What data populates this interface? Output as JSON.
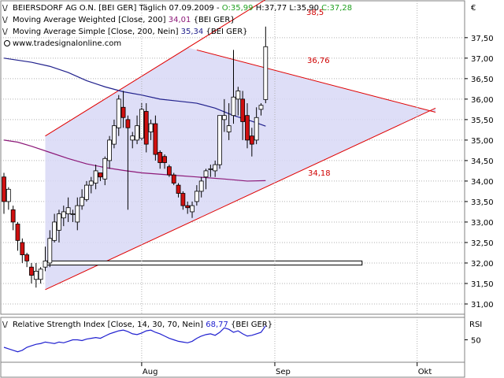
{
  "currency_symbol": "€",
  "colors": {
    "up": "#ffffff",
    "down": "#d01010",
    "channel_fill": "#d8d8f6",
    "channel_line": "#e00000",
    "ma_simple": "#20208c",
    "ma_weighted": "#8c1878",
    "rsi": "#2020d0",
    "grid": "#b0b0b0",
    "value_label": "#d00000"
  },
  "legend": {
    "price": {
      "name": "BEIERSDORF AG O.N. [BEI GER]  Täglich 07.09.2009 -",
      "o_label": "O:35,99",
      "h_label": "H:37,77",
      "l_label": "L:35,90",
      "c_label": "C:37,28"
    },
    "wma": {
      "name": "Moving Average Weighted [Close, 200]",
      "value": "34,01",
      "symbol": "{BEI GER}"
    },
    "sma": {
      "name": "Moving Average Simple [Close, 200, Nein]",
      "value": "35,34",
      "symbol": "{BEI GER}"
    },
    "source": "www.tradesignalonline.com"
  },
  "rsi_legend": {
    "name": "Relative Strength Index [Close, 14, 30, 70, Nein]",
    "value": "68,77",
    "symbol": "{BEI GER}",
    "axis_title": "RSI"
  },
  "annotations": {
    "upper_channel": "38,5",
    "mid_line": "36,76",
    "lower_channel": "34,18"
  },
  "chart_data": [
    {
      "type": "candlestick",
      "title": "BEIERSDORF AG O.N. [BEI GER] Täglich",
      "ylim": [
        30.75,
        38.4
      ],
      "y_ticks": [
        "31,00",
        "31,50",
        "32,00",
        "32,50",
        "33,00",
        "33,50",
        "34,00",
        "34,50",
        "35,00",
        "35,50",
        "36,00",
        "36,50",
        "37,00",
        "37,50"
      ],
      "y_tick_values": [
        31.0,
        31.5,
        32.0,
        32.5,
        33.0,
        33.5,
        34.0,
        34.5,
        35.0,
        35.5,
        36.0,
        36.5,
        37.0,
        37.5
      ],
      "x_ticks": [
        "Aug",
        "Sep",
        "Okt"
      ],
      "x_tick_index": [
        30,
        59,
        90
      ],
      "grid": true,
      "candles": [
        {
          "o": 34.1,
          "h": 34.2,
          "l": 33.2,
          "c": 33.5
        },
        {
          "o": 33.5,
          "h": 33.85,
          "l": 33.3,
          "c": 33.8
        },
        {
          "o": 33.3,
          "h": 33.4,
          "l": 32.8,
          "c": 33.0
        },
        {
          "o": 32.95,
          "h": 33.0,
          "l": 32.3,
          "c": 32.55
        },
        {
          "o": 32.5,
          "h": 32.6,
          "l": 32.0,
          "c": 32.2
        },
        {
          "o": 32.2,
          "h": 32.25,
          "l": 31.9,
          "c": 32.05
        },
        {
          "o": 31.9,
          "h": 32.0,
          "l": 31.5,
          "c": 31.7
        },
        {
          "o": 31.6,
          "h": 32.0,
          "l": 31.4,
          "c": 31.8
        },
        {
          "o": 31.6,
          "h": 31.9,
          "l": 31.5,
          "c": 31.85
        },
        {
          "o": 31.9,
          "h": 32.4,
          "l": 31.8,
          "c": 32.05
        },
        {
          "o": 32.0,
          "h": 32.8,
          "l": 31.9,
          "c": 32.6
        },
        {
          "o": 32.55,
          "h": 33.2,
          "l": 32.5,
          "c": 33.0
        },
        {
          "o": 32.8,
          "h": 33.3,
          "l": 32.5,
          "c": 33.2
        },
        {
          "o": 33.1,
          "h": 33.4,
          "l": 32.9,
          "c": 33.25
        },
        {
          "o": 33.2,
          "h": 33.6,
          "l": 33.0,
          "c": 33.35
        },
        {
          "o": 33.2,
          "h": 33.3,
          "l": 33.0,
          "c": 33.2
        },
        {
          "o": 33.0,
          "h": 33.6,
          "l": 32.8,
          "c": 33.4
        },
        {
          "o": 33.4,
          "h": 33.8,
          "l": 33.3,
          "c": 33.6
        },
        {
          "o": 33.55,
          "h": 34.0,
          "l": 33.5,
          "c": 33.9
        },
        {
          "o": 33.9,
          "h": 34.1,
          "l": 33.7,
          "c": 34.0
        },
        {
          "o": 33.95,
          "h": 34.4,
          "l": 33.8,
          "c": 34.25
        },
        {
          "o": 34.2,
          "h": 34.2,
          "l": 34.0,
          "c": 34.1
        },
        {
          "o": 34.05,
          "h": 34.6,
          "l": 33.9,
          "c": 34.55
        },
        {
          "o": 34.5,
          "h": 35.1,
          "l": 34.3,
          "c": 35.0
        },
        {
          "o": 34.9,
          "h": 35.5,
          "l": 34.8,
          "c": 35.35
        },
        {
          "o": 35.3,
          "h": 36.1,
          "l": 35.1,
          "c": 36.0
        },
        {
          "o": 35.8,
          "h": 36.2,
          "l": 35.3,
          "c": 35.55
        },
        {
          "o": 35.5,
          "h": 35.6,
          "l": 33.3,
          "c": 35.3
        },
        {
          "o": 35.0,
          "h": 35.2,
          "l": 34.8,
          "c": 35.1
        },
        {
          "o": 35.0,
          "h": 35.6,
          "l": 34.9,
          "c": 35.35
        },
        {
          "o": 35.05,
          "h": 35.9,
          "l": 35.0,
          "c": 35.75
        },
        {
          "o": 35.7,
          "h": 35.9,
          "l": 34.7,
          "c": 34.9
        },
        {
          "o": 35.2,
          "h": 35.5,
          "l": 35.0,
          "c": 35.4
        },
        {
          "o": 35.4,
          "h": 35.6,
          "l": 34.5,
          "c": 34.65
        },
        {
          "o": 34.7,
          "h": 34.75,
          "l": 34.3,
          "c": 34.45
        },
        {
          "o": 34.6,
          "h": 34.65,
          "l": 34.3,
          "c": 34.45
        },
        {
          "o": 34.35,
          "h": 34.4,
          "l": 34.1,
          "c": 34.15
        },
        {
          "o": 34.15,
          "h": 34.2,
          "l": 33.9,
          "c": 33.95
        },
        {
          "o": 33.9,
          "h": 33.95,
          "l": 33.6,
          "c": 33.7
        },
        {
          "o": 33.7,
          "h": 33.75,
          "l": 33.3,
          "c": 33.4
        },
        {
          "o": 33.4,
          "h": 33.5,
          "l": 33.2,
          "c": 33.35
        },
        {
          "o": 33.25,
          "h": 33.5,
          "l": 33.1,
          "c": 33.4
        },
        {
          "o": 33.5,
          "h": 33.9,
          "l": 33.4,
          "c": 33.75
        },
        {
          "o": 33.75,
          "h": 34.1,
          "l": 33.6,
          "c": 34.0
        },
        {
          "o": 34.1,
          "h": 34.3,
          "l": 33.8,
          "c": 34.25
        },
        {
          "o": 34.3,
          "h": 34.4,
          "l": 34.1,
          "c": 34.3
        },
        {
          "o": 34.25,
          "h": 34.5,
          "l": 34.1,
          "c": 34.4
        },
        {
          "o": 34.4,
          "h": 35.6,
          "l": 34.3,
          "c": 35.6
        },
        {
          "o": 35.5,
          "h": 36.0,
          "l": 35.2,
          "c": 35.6
        },
        {
          "o": 35.2,
          "h": 35.9,
          "l": 35.0,
          "c": 35.35
        },
        {
          "o": 35.6,
          "h": 37.2,
          "l": 35.4,
          "c": 36.05
        },
        {
          "o": 36.0,
          "h": 36.3,
          "l": 35.6,
          "c": 36.2
        },
        {
          "o": 36.0,
          "h": 36.2,
          "l": 35.0,
          "c": 35.45
        },
        {
          "o": 35.6,
          "h": 35.9,
          "l": 34.8,
          "c": 35.0
        },
        {
          "o": 35.1,
          "h": 35.3,
          "l": 34.6,
          "c": 34.9
        },
        {
          "o": 35.0,
          "h": 35.8,
          "l": 34.9,
          "c": 35.55
        },
        {
          "o": 35.75,
          "h": 35.9,
          "l": 35.6,
          "c": 35.85
        },
        {
          "o": 35.99,
          "h": 37.77,
          "l": 35.9,
          "c": 37.28
        }
      ],
      "sma_200": [
        {
          "i": 0,
          "v": 37.0
        },
        {
          "i": 3,
          "v": 36.95
        },
        {
          "i": 6,
          "v": 36.9
        },
        {
          "i": 10,
          "v": 36.8
        },
        {
          "i": 14,
          "v": 36.65
        },
        {
          "i": 18,
          "v": 36.45
        },
        {
          "i": 22,
          "v": 36.3
        },
        {
          "i": 26,
          "v": 36.18
        },
        {
          "i": 30,
          "v": 36.1
        },
        {
          "i": 34,
          "v": 36.0
        },
        {
          "i": 38,
          "v": 35.95
        },
        {
          "i": 42,
          "v": 35.9
        },
        {
          "i": 46,
          "v": 35.78
        },
        {
          "i": 50,
          "v": 35.6
        },
        {
          "i": 54,
          "v": 35.46
        },
        {
          "i": 57,
          "v": 35.34
        }
      ],
      "wma_200": [
        {
          "i": 0,
          "v": 35.0
        },
        {
          "i": 3,
          "v": 34.95
        },
        {
          "i": 6,
          "v": 34.85
        },
        {
          "i": 10,
          "v": 34.7
        },
        {
          "i": 14,
          "v": 34.55
        },
        {
          "i": 18,
          "v": 34.42
        },
        {
          "i": 22,
          "v": 34.33
        },
        {
          "i": 26,
          "v": 34.26
        },
        {
          "i": 30,
          "v": 34.2
        },
        {
          "i": 36,
          "v": 34.15
        },
        {
          "i": 42,
          "v": 34.1
        },
        {
          "i": 48,
          "v": 34.05
        },
        {
          "i": 53,
          "v": 34.0
        },
        {
          "i": 57,
          "v": 34.01
        }
      ],
      "channel": {
        "lower_start": {
          "i": 9,
          "v": 31.35
        },
        "lower_end": {
          "i": 94,
          "v": 35.78
        },
        "upper_start": {
          "i": 9,
          "v": 35.1
        },
        "upper_end": {
          "i": 58,
          "v": 38.5
        }
      },
      "resistance_line": {
        "start": {
          "i": 42,
          "v": 37.2
        },
        "end": {
          "i": 94,
          "v": 35.68
        }
      },
      "support_box": {
        "start_i": 9,
        "end_i": 78,
        "low": 31.95,
        "high": 32.05
      }
    },
    {
      "type": "line",
      "title": "Relative Strength Index [Close, 14, 30, 70, Nein]",
      "ylim": [
        20,
        80
      ],
      "y_ticks": [
        "50"
      ],
      "y_tick_values": [
        50
      ],
      "values": [
        40,
        38,
        36,
        34,
        36,
        40,
        42,
        44,
        45,
        47,
        46,
        45,
        47,
        46,
        48,
        50,
        50,
        49,
        51,
        52,
        53,
        52,
        55,
        58,
        60,
        62,
        63,
        61,
        58,
        57,
        59,
        62,
        63,
        60,
        58,
        55,
        52,
        50,
        48,
        47,
        46,
        48,
        52,
        55,
        57,
        58,
        56,
        60,
        66,
        64,
        60,
        62,
        58,
        55,
        56,
        58,
        60,
        68.77
      ]
    }
  ]
}
